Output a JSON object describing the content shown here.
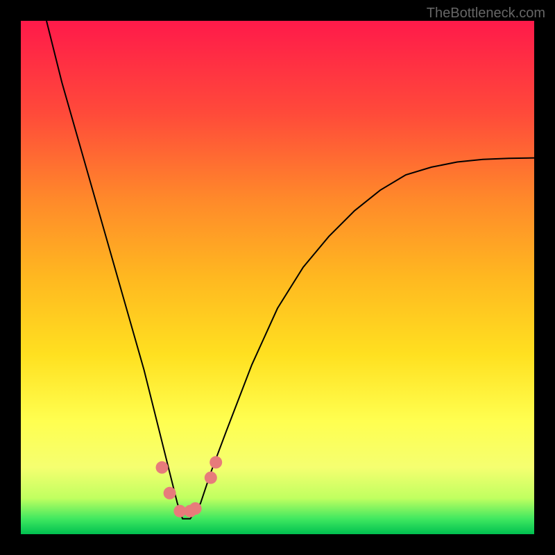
{
  "watermark": "TheBottleneck.com",
  "chart_data": {
    "type": "line",
    "title": "",
    "xlabel": "",
    "ylabel": "",
    "xlim": [
      0,
      100
    ],
    "ylim": [
      0,
      100
    ],
    "background_gradient": [
      "#ff1a4a",
      "#ff6a2a",
      "#ffb020",
      "#ffe020",
      "#ffff40",
      "#f0ff60",
      "#b0ff50",
      "#00e060",
      "#00c050"
    ],
    "series": [
      {
        "name": "bottleneck-curve",
        "x": [
          5,
          8,
          12,
          16,
          20,
          24,
          27,
          29,
          30.5,
          31.5,
          33,
          35,
          37,
          40,
          45,
          50,
          55,
          60,
          65,
          70,
          75,
          80,
          85,
          90,
          95,
          100
        ],
        "y": [
          100,
          88,
          74,
          60,
          46,
          32,
          20,
          12,
          6,
          3,
          3,
          6,
          12,
          20,
          33,
          44,
          52,
          58,
          63,
          67,
          70,
          71.5,
          72.5,
          73,
          73.2,
          73.3
        ]
      }
    ],
    "markers": {
      "name": "bottleneck-points",
      "x": [
        27.5,
        29,
        31,
        33,
        34,
        37,
        38
      ],
      "y": [
        13,
        8,
        4.5,
        4.5,
        5,
        11,
        14
      ]
    },
    "marker_color": "#e77b7b",
    "curve_color": "#000000"
  }
}
